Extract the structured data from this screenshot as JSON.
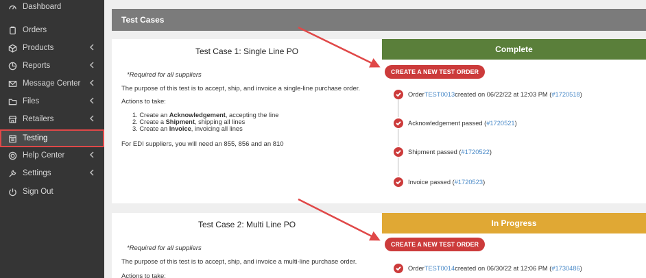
{
  "sidebar": {
    "items": [
      {
        "label": "Dashboard",
        "icon": "speedometer-icon",
        "chevron": false
      },
      {
        "label": "Orders",
        "icon": "clipboard-icon",
        "chevron": false
      },
      {
        "label": "Products",
        "icon": "box-icon",
        "chevron": true
      },
      {
        "label": "Reports",
        "icon": "chart-icon",
        "chevron": true
      },
      {
        "label": "Message Center",
        "icon": "envelope-icon",
        "chevron": true
      },
      {
        "label": "Files",
        "icon": "folder-icon",
        "chevron": true
      },
      {
        "label": "Retailers",
        "icon": "store-icon",
        "chevron": true
      },
      {
        "label": "Testing",
        "icon": "calendar-icon",
        "chevron": false
      },
      {
        "label": "Help Center",
        "icon": "lifebuoy-icon",
        "chevron": true
      },
      {
        "label": "Settings",
        "icon": "wrench-icon",
        "chevron": true
      },
      {
        "label": "Sign Out",
        "icon": "power-icon",
        "chevron": false
      }
    ]
  },
  "header": {
    "title": "Test Cases"
  },
  "test_cases": [
    {
      "title": "Test Case 1: Single Line PO",
      "required": "*Required for all suppliers",
      "purpose": "The purpose of this test is to accept, ship, and invoice a single-line purchase order.",
      "actions_label": "Actions to take:",
      "actions": [
        {
          "prefix": "1. Create an ",
          "bold": "Acknowledgement",
          "suffix": ", accepting the line"
        },
        {
          "prefix": "2. Create a ",
          "bold": "Shipment",
          "suffix": ", shipping all lines"
        },
        {
          "prefix": "3. Create an ",
          "bold": "Invoice",
          "suffix": ", invoicing all lines"
        }
      ],
      "edi_note": "For EDI suppliers, you will need an 855, 856 and an 810",
      "status": "Complete",
      "button": "CREATE A NEW TEST ORDER",
      "timeline": [
        {
          "pre": "Order ",
          "link1": "TEST0013",
          "mid": " created on 06/22/22 at 12:03 PM (",
          "link2": "#1720518",
          "post": ")"
        },
        {
          "pre": "Acknowledgement passed (",
          "link1": "",
          "mid": "",
          "link2": "#1720521",
          "post": ")"
        },
        {
          "pre": "Shipment passed (",
          "link1": "",
          "mid": "",
          "link2": "#1720522",
          "post": ")"
        },
        {
          "pre": "Invoice passed (",
          "link1": "",
          "mid": "",
          "link2": "#1720523",
          "post": ")"
        }
      ]
    },
    {
      "title": "Test Case 2: Multi Line PO",
      "required": "*Required for all suppliers",
      "purpose": "The purpose of this test is to accept, ship, and invoice a multi-line purchase order.",
      "actions_label": "Actions to take:",
      "status": "In Progress",
      "button": "CREATE A NEW TEST ORDER",
      "timeline": [
        {
          "pre": "Order ",
          "link1": "TEST0014",
          "mid": " created on 06/30/22 at 12:06 PM (",
          "link2": "#1730486",
          "post": ")"
        }
      ]
    }
  ],
  "colors": {
    "sidebar_bg": "#353535",
    "complete": "#5a7f3a",
    "in_progress": "#e0a834",
    "accent_red": "#cc3b3b",
    "link": "#4a8ac8"
  }
}
